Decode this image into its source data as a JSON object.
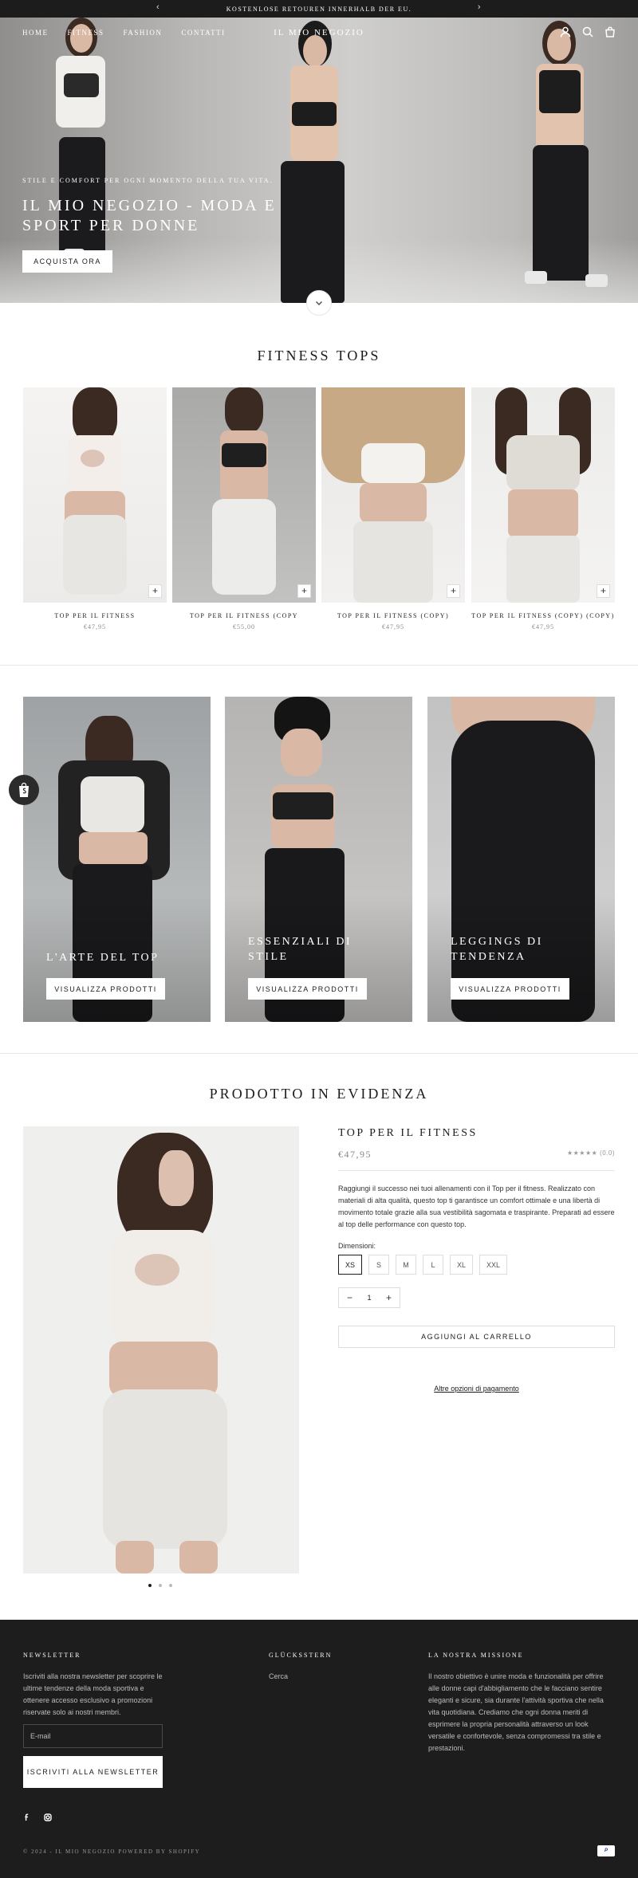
{
  "announcement": {
    "text": "KOSTENLOSE RETOUREN INNERHALB DER EU.",
    "prev_icon": "chevron-left-icon",
    "next_icon": "chevron-right-icon"
  },
  "header": {
    "nav": [
      "HOME",
      "FITNESS",
      "FASHION",
      "CONTATTI"
    ],
    "logo": "IL MIO NEGOZIO",
    "icons": [
      "account-icon",
      "search-icon",
      "cart-icon"
    ]
  },
  "hero": {
    "subtitle": "STILE E COMFORT PER OGNI MOMENTO DELLA TUA VITA.",
    "title": "IL MIO NEGOZIO - MODA E SPORT PER DONNE",
    "cta": "ACQUISTA ORA"
  },
  "fitness_tops": {
    "title": "FITNESS TOPS",
    "products": [
      {
        "name": "TOP PER IL FITNESS",
        "price": "€47,95"
      },
      {
        "name": "TOP PER IL FITNESS (COPY",
        "price": "€55,00"
      },
      {
        "name": "TOP PER IL FITNESS (COPY)",
        "price": "€47,95"
      },
      {
        "name": "TOP PER IL FITNESS (COPY) (COPY)",
        "price": "€47,95"
      }
    ]
  },
  "collections": [
    {
      "title": "L'ARTE DEL TOP",
      "button": "VISUALIZZA PRODOTTI"
    },
    {
      "title": "ESSENZIALI DI STILE",
      "button": "VISUALIZZA PRODOTTI"
    },
    {
      "title": "LEGGINGS DI TENDENZA",
      "button": "VISUALIZZA PRODOTTI"
    }
  ],
  "featured": {
    "section_title": "PRODOTTO IN EVIDENZA",
    "name": "TOP PER IL FITNESS",
    "price": "€47,95",
    "rating_stars": "★★★★★",
    "rating_text": "(0.0)",
    "description": "Raggiungi il successo nei tuoi allenamenti con il Top per il fitness. Realizzato con materiali di alta qualità, questo top ti garantisce un comfort ottimale e una libertà di movimento totale grazie alla sua vestibilità sagomata e traspirante. Preparati ad essere al top delle performance con questo top.",
    "dimension_label": "Dimensioni:",
    "sizes": [
      "XS",
      "S",
      "M",
      "L",
      "XL",
      "XXL"
    ],
    "selected_size": "XS",
    "quantity": "1",
    "add_to_cart": "AGGIUNGI AL CARRELLO",
    "more_payment": "Altre opzioni di pagamento",
    "gallery_count": 3,
    "gallery_active": 1
  },
  "footer": {
    "newsletter_title": "NEWSLETTER",
    "newsletter_text": "Iscriviti alla nostra newsletter per scoprire le ultime tendenze della moda sportiva e ottenere accesso esclusivo a promozioni riservate solo ai nostri membri.",
    "email_placeholder": "E-mail",
    "subscribe": "ISCRIVITI ALLA NEWSLETTER",
    "col2_title": "GLÜCKSSTERN",
    "col2_link": "Cerca",
    "col3_title": "LA NOSTRA MISSIONE",
    "col3_text": "Il nostro obiettivo è unire moda e funzionalità per offrire alle donne capi d'abbigliamento che le facciano sentire eleganti e sicure, sia durante l'attività sportiva che nella vita quotidiana. Crediamo che ogni donna meriti di esprimere la propria personalità attraverso un look versatile e confortevole, senza compromessi tra stile e prestazioni.",
    "social": [
      "facebook-icon",
      "instagram-icon"
    ],
    "copyright": "© 2024 - IL MIO NEGOZIO POWERED BY SHOPIFY",
    "payment_label": "P"
  }
}
